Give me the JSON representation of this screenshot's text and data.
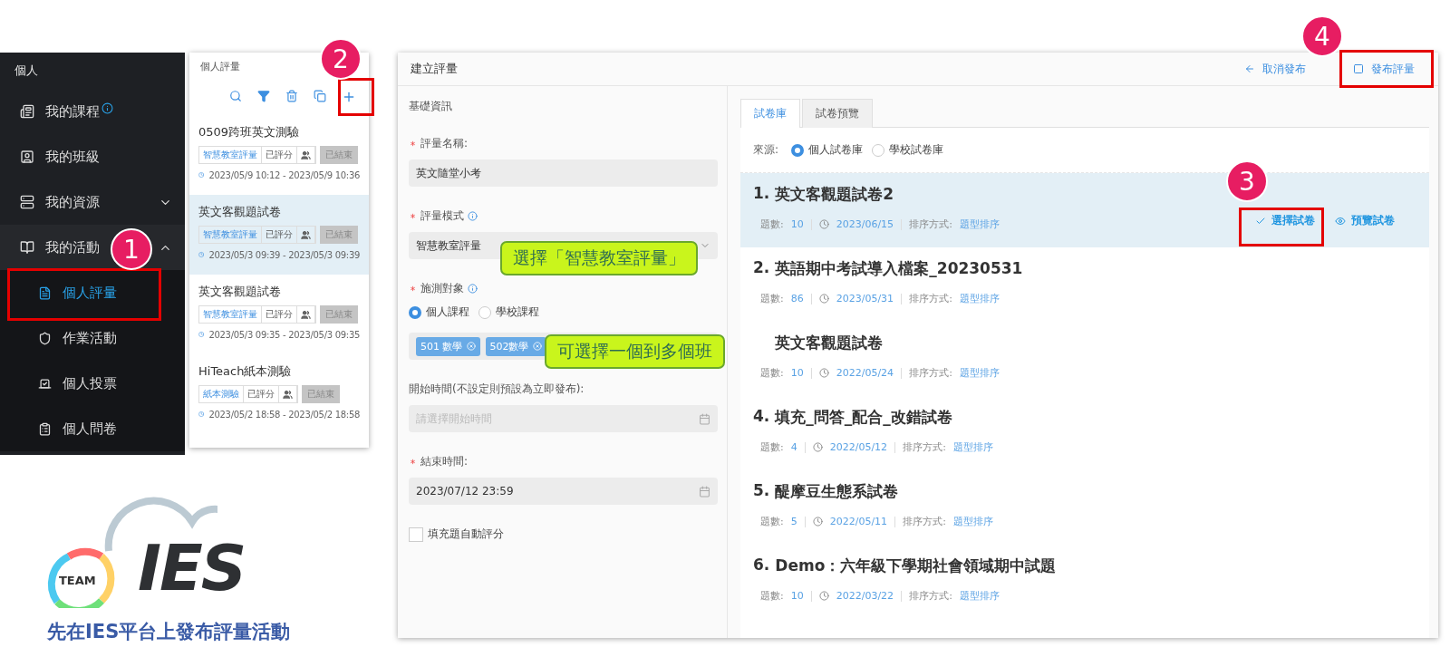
{
  "sidebar": {
    "heading": "個人",
    "items": [
      {
        "label": "我的課程",
        "info": true,
        "selected": false
      },
      {
        "label": "我的班級",
        "info": false,
        "selected": false
      },
      {
        "label": "我的資源",
        "info": false,
        "expanded": false,
        "selected": false
      },
      {
        "label": "我的活動",
        "info": false,
        "expanded": true,
        "selected": false,
        "children": [
          {
            "label": "個人評量",
            "selected": true
          },
          {
            "label": "作業活動",
            "selected": false
          },
          {
            "label": "個人投票",
            "selected": false
          },
          {
            "label": "個人問卷",
            "selected": false
          }
        ]
      }
    ]
  },
  "list_panel": {
    "title": "個人評量",
    "items": [
      {
        "title": "0509跨班英文測驗",
        "mode": "智慧教室評量",
        "scored": "已評分",
        "status": "已結束",
        "time": "2023/05/9 10:12 - 2023/05/9 10:36",
        "selected": false
      },
      {
        "title": "英文客觀題試卷",
        "mode": "智慧教室評量",
        "scored": "已評分",
        "status": "已結束",
        "time": "2023/05/3 09:39 - 2023/05/3 09:39",
        "selected": true
      },
      {
        "title": "英文客觀題試卷",
        "mode": "智慧教室評量",
        "scored": "已評分",
        "status": "已結束",
        "time": "2023/05/3 09:35 - 2023/05/3 09:35",
        "selected": false
      },
      {
        "title": "HiTeach紙本測驗",
        "mode": "紙本測驗",
        "scored": "已評分",
        "status": "已結束",
        "time": "2023/05/2 18:58 - 2023/05/2 18:58",
        "selected": false
      }
    ]
  },
  "window": {
    "title": "建立評量",
    "actions": [
      {
        "label": "取消發布",
        "kind": "back"
      },
      {
        "label": "發布評量",
        "kind": "publish"
      }
    ]
  },
  "form": {
    "section": "基礎資訊",
    "fields": [
      {
        "kind": "text",
        "label": "評量名稱:",
        "required": true,
        "info": false,
        "value": "英文隨堂小考"
      },
      {
        "kind": "select",
        "label": "評量模式",
        "required": true,
        "info": true,
        "value": "智慧教室評量"
      },
      {
        "kind": "target",
        "label": "施測對象",
        "required": true,
        "info": true,
        "options": [
          {
            "label": "個人課程",
            "selected": true
          },
          {
            "label": "學校課程",
            "selected": false
          }
        ],
        "tags": [
          "501 數學",
          "502數學"
        ]
      },
      {
        "kind": "date",
        "label": "開始時間(不設定則預設為立即發布):",
        "required": false,
        "info": false,
        "placeholder": "請選擇開始時間"
      },
      {
        "kind": "date",
        "label": "結束時間:",
        "required": true,
        "info": false,
        "value": "2023/07/12 23:59"
      },
      {
        "kind": "checkbox",
        "label": "填充題自動評分",
        "checked": false
      }
    ]
  },
  "tabs": [
    {
      "label": "試卷庫",
      "selected": true
    },
    {
      "label": "試卷預覽",
      "selected": false
    }
  ],
  "source": {
    "label": "來源:",
    "options": [
      {
        "label": "個人試卷庫",
        "selected": true
      },
      {
        "label": "學校試卷庫",
        "selected": false
      }
    ]
  },
  "papers": [
    {
      "number": "1.",
      "title": "英文客觀題試卷2",
      "count_label": "題數:",
      "count": "10",
      "date": "2023/06/15",
      "sort_label": "排序方式:",
      "sort": "題型排序",
      "selected": true,
      "actions": [
        {
          "label": "選擇試卷",
          "kind": "select"
        },
        {
          "label": "預覽試卷",
          "kind": "preview"
        }
      ]
    },
    {
      "number": "2.",
      "title": "英語期中考試導入檔案_20230531",
      "count_label": "題數:",
      "count": "86",
      "date": "2023/05/31",
      "sort_label": "排序方式:",
      "sort": "題型排序",
      "selected": false
    },
    {
      "title": "英文客觀題試卷",
      "count_label": "題數:",
      "count": "10",
      "date": "2022/05/24",
      "sort_label": "排序方式:",
      "sort": "題型排序",
      "selected": false
    },
    {
      "number": "4.",
      "title": "填充_問答_配合_改錯試卷",
      "count_label": "題數:",
      "count": "4",
      "date": "2022/05/12",
      "sort_label": "排序方式:",
      "sort": "題型排序",
      "selected": false
    },
    {
      "number": "5.",
      "title": "醍摩豆生態系試卷",
      "count_label": "題數:",
      "count": "5",
      "date": "2022/05/11",
      "sort_label": "排序方式:",
      "sort": "題型排序",
      "selected": false
    },
    {
      "number": "6.",
      "title": "Demo：六年級下學期社會領域期中試題",
      "count_label": "題數:",
      "count": "10",
      "date": "2022/03/22",
      "sort_label": "排序方式:",
      "sort": "題型排序",
      "selected": false
    }
  ],
  "annotations": {
    "badges": [
      "1",
      "2",
      "3",
      "4"
    ],
    "callouts": [
      "選擇「智慧教室評量」",
      "可選擇一個到多個班"
    ]
  },
  "logo": {
    "ring_text": "TEAM",
    "wordmark": "IES"
  },
  "caption": "先在IES平台上發布評量活動"
}
